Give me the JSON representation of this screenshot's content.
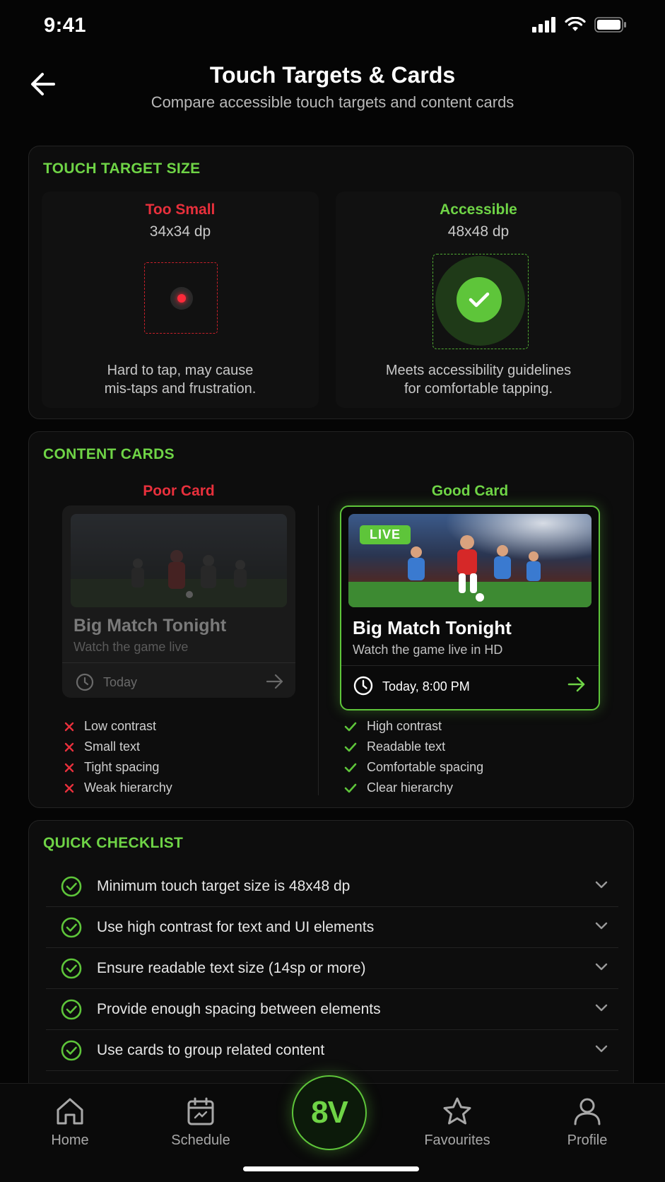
{
  "status_bar": {
    "time": "9:41"
  },
  "header": {
    "title": "Touch Targets & Cards",
    "subtitle": "Compare accessible touch targets and content cards"
  },
  "touch_target": {
    "section_title": "TOUCH TARGET SIZE",
    "small": {
      "label": "Too Small",
      "size": "34x34 dp",
      "desc_line1": "Hard to tap, may cause",
      "desc_line2": "mis-taps and frustration."
    },
    "accessible": {
      "label": "Accessible",
      "size": "48x48 dp",
      "desc_line1": "Meets accessibility guidelines",
      "desc_line2": "for comfortable tapping."
    }
  },
  "content_cards": {
    "section_title": "CONTENT CARDS",
    "poor": {
      "label": "Poor Card",
      "title": "Big Match Tonight",
      "subtitle": "Watch the game live",
      "time": "Today",
      "issues": [
        "Low contrast",
        "Small text",
        "Tight spacing",
        "Weak hierarchy"
      ]
    },
    "good": {
      "label": "Good Card",
      "badge": "LIVE",
      "title": "Big Match Tonight",
      "subtitle": "Watch the game live in HD",
      "time": "Today, 8:00 PM",
      "features": [
        "High contrast",
        "Readable text",
        "Comfortable spacing",
        "Clear hierarchy"
      ]
    }
  },
  "checklist": {
    "section_title": "QUICK CHECKLIST",
    "items": [
      "Minimum touch target size is 48x48 dp",
      "Use high contrast for text and UI elements",
      "Ensure readable text size (14sp or more)",
      "Provide enough spacing between elements",
      "Use cards to group related content"
    ]
  },
  "bottom_nav": {
    "items": [
      {
        "label": "Home",
        "icon": "home-icon"
      },
      {
        "label": "Schedule",
        "icon": "calendar-icon"
      },
      {
        "label": "Favourites",
        "icon": "star-icon"
      },
      {
        "label": "Profile",
        "icon": "user-icon"
      }
    ],
    "center_logo": "8V"
  },
  "colors": {
    "accent": "#6fd446",
    "error": "#e8303c",
    "background": "#050505"
  }
}
